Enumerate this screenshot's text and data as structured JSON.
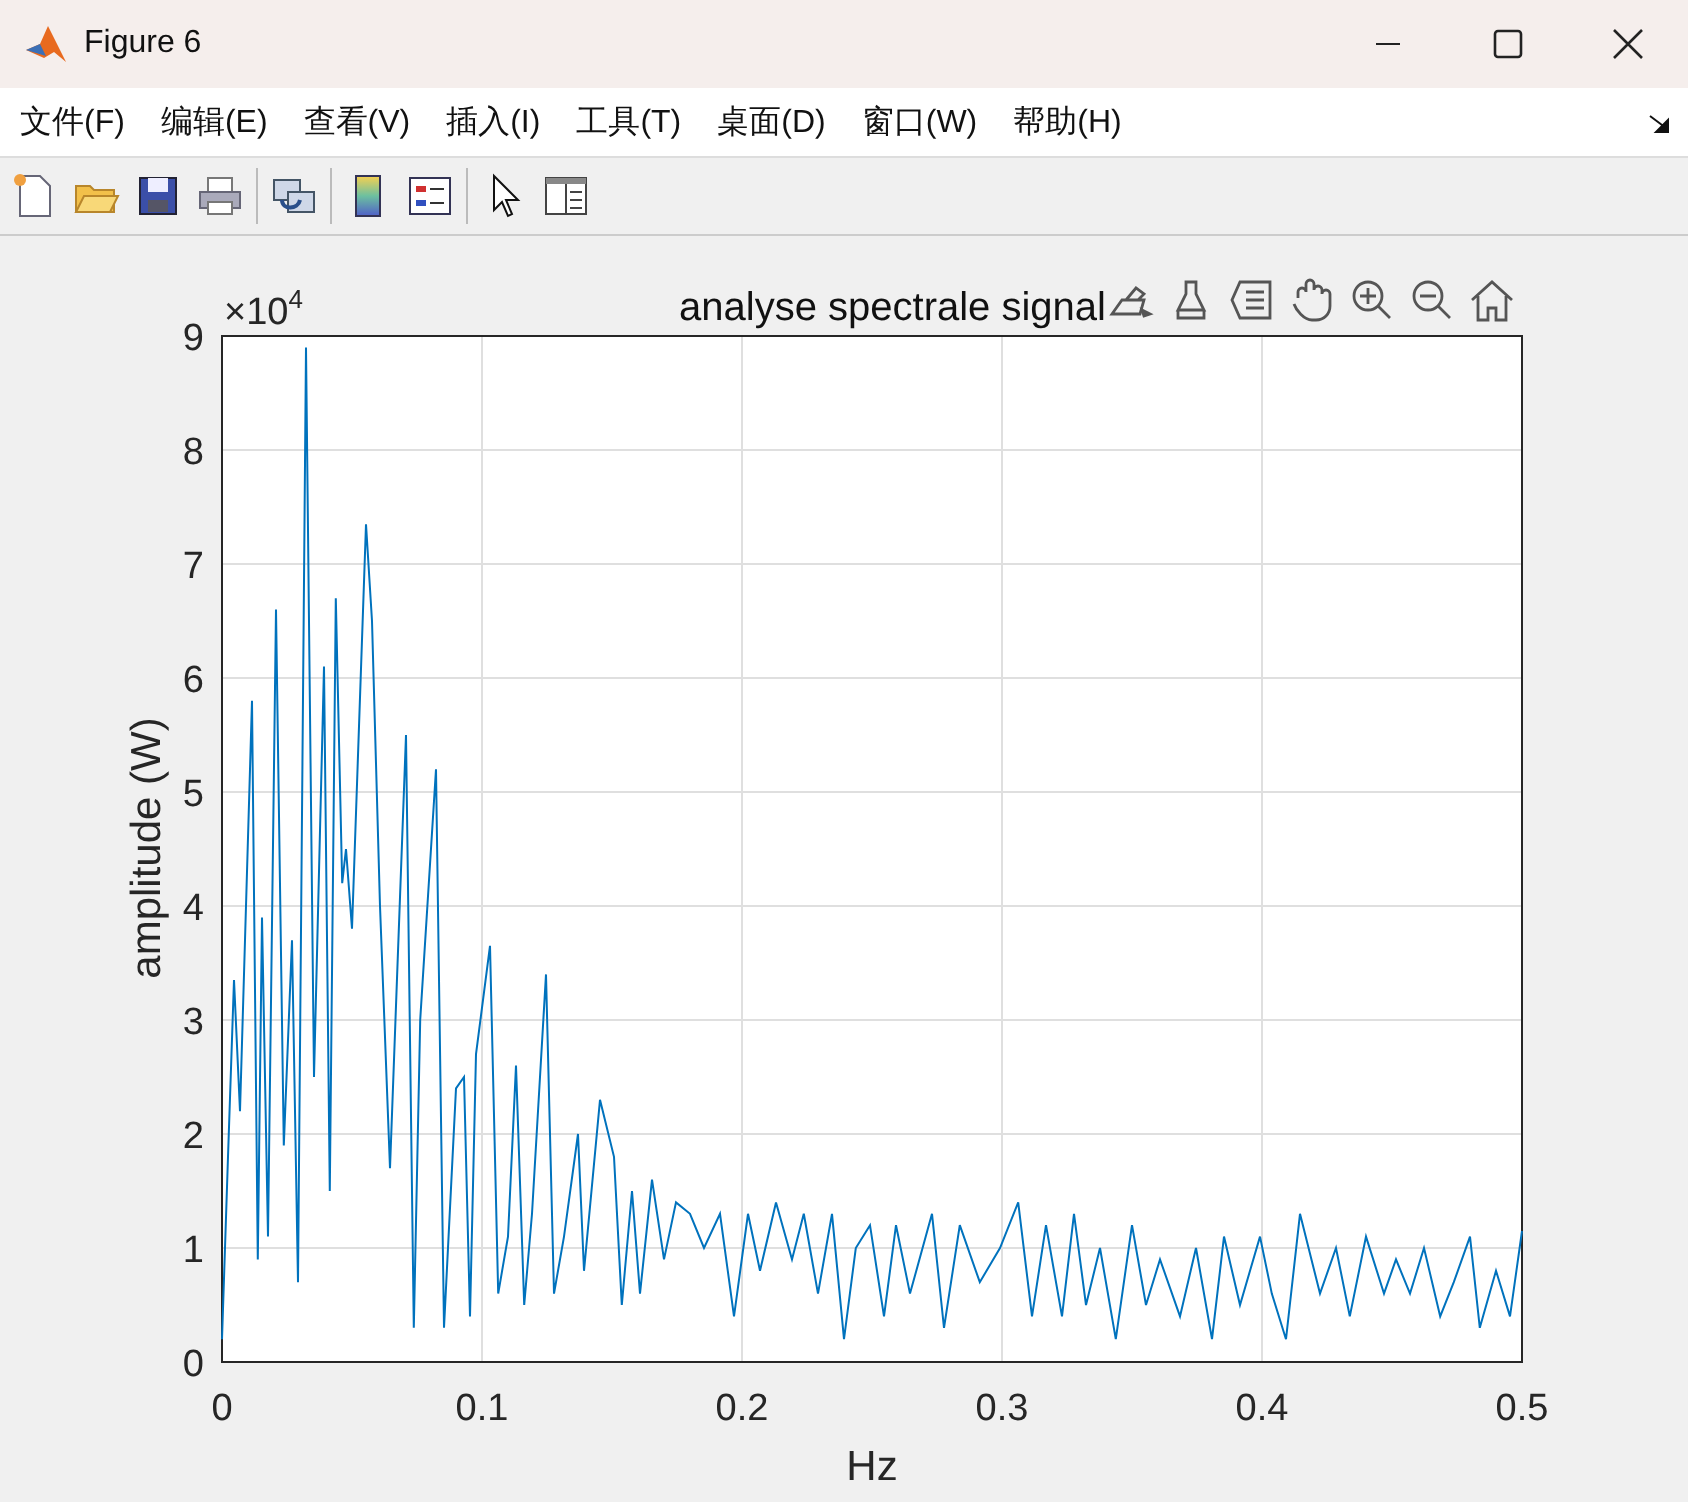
{
  "window": {
    "title": "Figure 6"
  },
  "menu": [
    "文件(F)",
    "编辑(E)",
    "查看(V)",
    "插入(I)",
    "工具(T)",
    "桌面(D)",
    "窗口(W)",
    "帮助(H)"
  ],
  "toolbar": [
    {
      "kind": "new"
    },
    {
      "kind": "open"
    },
    {
      "kind": "save"
    },
    {
      "kind": "print"
    },
    {
      "kind": "sep"
    },
    {
      "kind": "link"
    },
    {
      "kind": "sep"
    },
    {
      "kind": "colorbar"
    },
    {
      "kind": "legend"
    },
    {
      "kind": "sep"
    },
    {
      "kind": "pointer"
    },
    {
      "kind": "inspector"
    }
  ],
  "axes_toolbar": [
    {
      "kind": "export"
    },
    {
      "kind": "brush"
    },
    {
      "kind": "datatip"
    },
    {
      "kind": "pan"
    },
    {
      "kind": "zoomin"
    },
    {
      "kind": "zoomout"
    },
    {
      "kind": "home"
    }
  ],
  "plot": {
    "y_multiplier": {
      "base": "×10",
      "exponent": "4"
    },
    "chart_data": {
      "type": "line",
      "title": "analyse spectrale signal",
      "xlabel": "Hz",
      "ylabel": "amplitude (W)",
      "xlim": [
        0,
        0.5
      ],
      "ylim": [
        0,
        9
      ],
      "grid": true,
      "xticks": [
        0,
        0.1,
        0.2,
        0.3,
        0.4,
        0.5
      ],
      "yticks": [
        0,
        1,
        2,
        3,
        4,
        5,
        6,
        7,
        8,
        9
      ],
      "x": [
        0,
        0.0023,
        0.0046,
        0.0069,
        0.0115,
        0.0138,
        0.0154,
        0.0177,
        0.0208,
        0.0238,
        0.0269,
        0.0292,
        0.0323,
        0.0354,
        0.0392,
        0.0415,
        0.0438,
        0.0462,
        0.0477,
        0.05,
        0.0554,
        0.0577,
        0.0608,
        0.0646,
        0.0708,
        0.0738,
        0.0762,
        0.0823,
        0.0854,
        0.09,
        0.0931,
        0.0954,
        0.0977,
        0.1031,
        0.1062,
        0.11,
        0.1131,
        0.1162,
        0.1192,
        0.1246,
        0.1277,
        0.1315,
        0.1369,
        0.1392,
        0.1454,
        0.1508,
        0.1538,
        0.1577,
        0.1608,
        0.1654,
        0.17,
        0.1746,
        0.18,
        0.1854,
        0.1915,
        0.1969,
        0.2023,
        0.2069,
        0.2131,
        0.2192,
        0.2238,
        0.2292,
        0.2346,
        0.2392,
        0.2438,
        0.2492,
        0.2546,
        0.2592,
        0.2646,
        0.2731,
        0.2777,
        0.2838,
        0.2915,
        0.2992,
        0.3062,
        0.3115,
        0.3169,
        0.3231,
        0.3277,
        0.3323,
        0.3377,
        0.3438,
        0.35,
        0.3554,
        0.3608,
        0.3685,
        0.3746,
        0.3808,
        0.3854,
        0.3915,
        0.3992,
        0.4038,
        0.4092,
        0.4146,
        0.4223,
        0.4285,
        0.4338,
        0.44,
        0.4469,
        0.4515,
        0.4569,
        0.4623,
        0.4685,
        0.4738,
        0.48,
        0.4838,
        0.49,
        0.4954,
        0.5
      ],
      "series": [
        {
          "color": "#0072bd",
          "values": [
            0.2,
            1.8,
            3.35,
            2.2,
            5.8,
            0.9,
            3.9,
            1.1,
            6.6,
            1.9,
            3.7,
            0.7,
            8.9,
            2.5,
            6.1,
            1.5,
            6.7,
            4.2,
            4.5,
            3.8,
            7.35,
            6.5,
            4.0,
            1.7,
            5.5,
            0.3,
            3.0,
            5.2,
            0.3,
            2.4,
            2.5,
            0.4,
            2.7,
            3.65,
            0.6,
            1.1,
            2.6,
            0.5,
            1.3,
            3.4,
            0.6,
            1.1,
            2.0,
            0.8,
            2.3,
            1.8,
            0.5,
            1.5,
            0.6,
            1.6,
            0.9,
            1.4,
            1.3,
            1.0,
            1.3,
            0.4,
            1.3,
            0.8,
            1.4,
            0.9,
            1.3,
            0.6,
            1.3,
            0.2,
            1.0,
            1.2,
            0.4,
            1.2,
            0.6,
            1.3,
            0.3,
            1.2,
            0.7,
            1.0,
            1.4,
            0.4,
            1.2,
            0.4,
            1.3,
            0.5,
            1.0,
            0.2,
            1.2,
            0.5,
            0.9,
            0.4,
            1.0,
            0.2,
            1.1,
            0.5,
            1.1,
            0.6,
            0.2,
            1.3,
            0.6,
            1.0,
            0.4,
            1.1,
            0.6,
            0.9,
            0.6,
            1.0,
            0.4,
            0.7,
            1.1,
            0.3,
            0.8,
            0.4,
            1.15
          ]
        }
      ]
    }
  }
}
